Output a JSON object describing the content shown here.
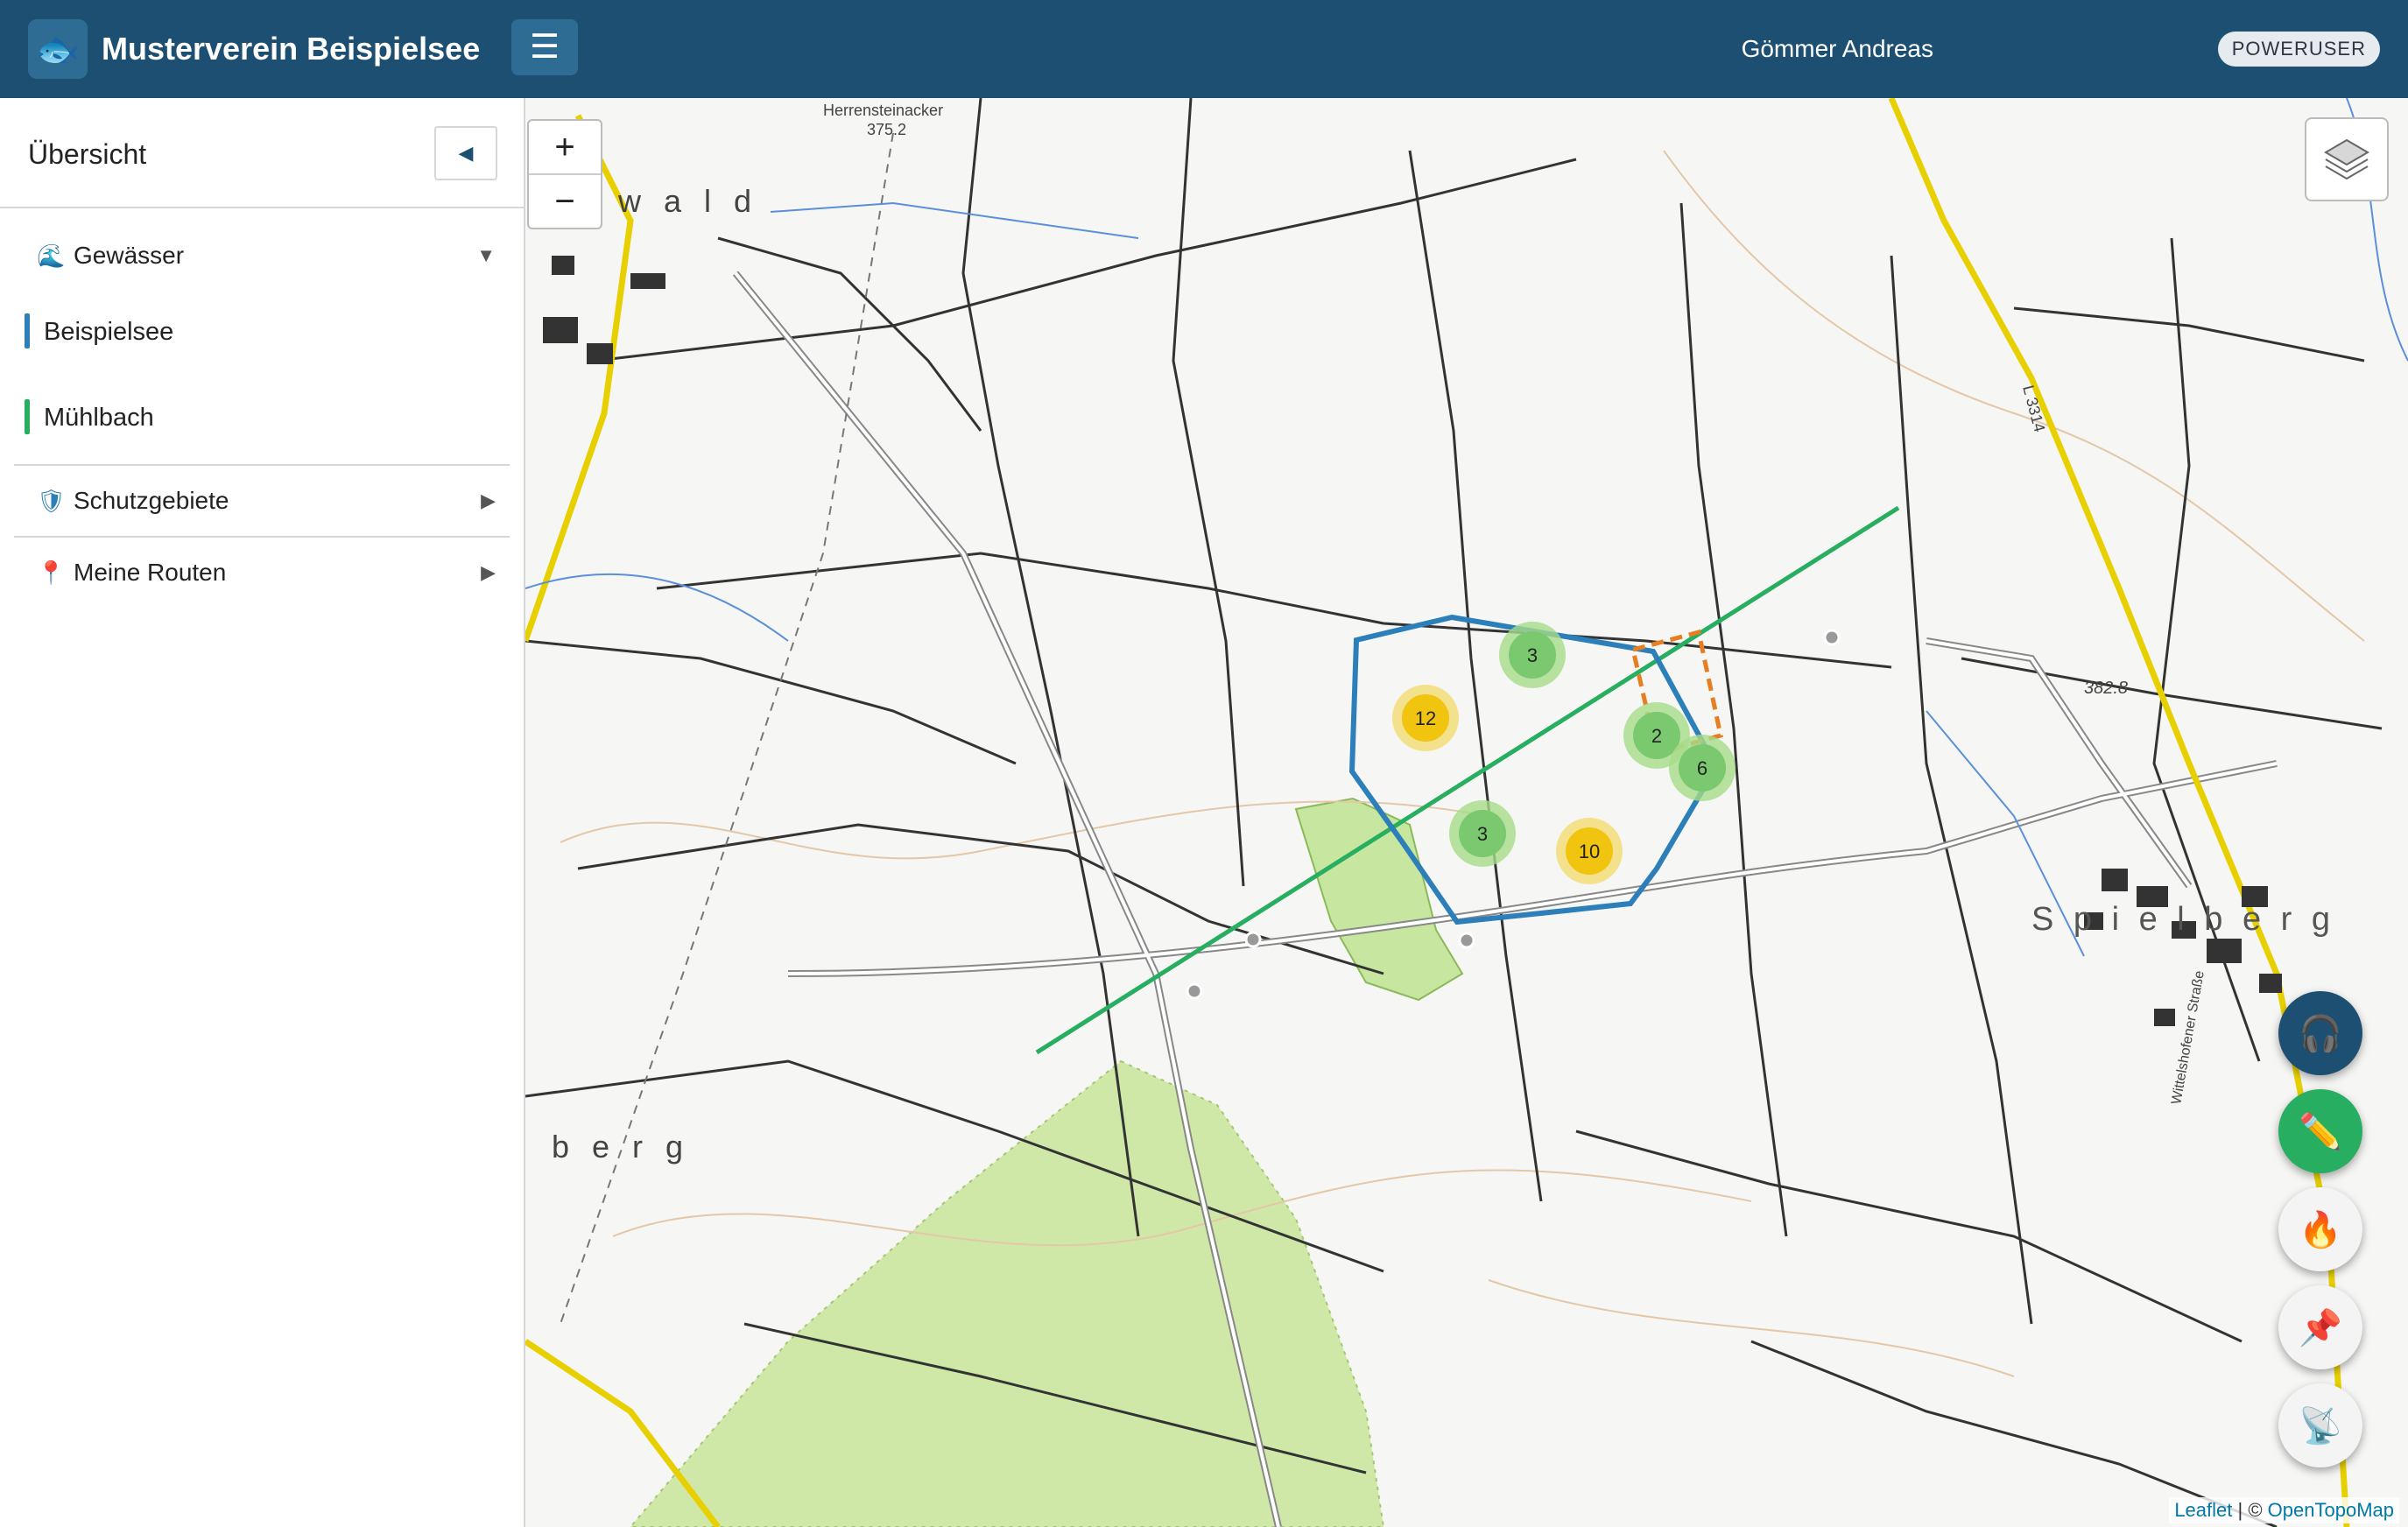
{
  "header": {
    "brand_icon": "fish-icon",
    "title": "Musterverein Beispielsee",
    "menu_icon": "hamburger-icon",
    "user_name": "Gömmer Andreas",
    "role_badge": "POWERUSER",
    "background": "#1d4f73"
  },
  "sidebar": {
    "title": "Übersicht",
    "collapse_icon": "triangle-left-icon",
    "groups": [
      {
        "label": "Gewässer",
        "icon": "water-wave-icon",
        "expanded": true,
        "items": [
          {
            "label": "Beispielsee",
            "color": "#2c7fb8"
          },
          {
            "label": "Mühlbach",
            "color": "#27ae60"
          }
        ]
      },
      {
        "label": "Schutzgebiete",
        "icon": "shield-icon",
        "expanded": false
      },
      {
        "label": "Meine Routen",
        "icon": "pin-icon",
        "expanded": false
      }
    ]
  },
  "map": {
    "zoom_in": "+",
    "zoom_out": "−",
    "place_labels": [
      "Herrensteinacker",
      "375.2",
      "n w a l d",
      "S p i e l b e r g",
      "b e r g",
      "382.8",
      "L 3314",
      "Wittelshofener Straße"
    ],
    "clusters": [
      {
        "count": "3",
        "color": "green"
      },
      {
        "count": "12",
        "color": "yellow"
      },
      {
        "count": "2",
        "color": "green"
      },
      {
        "count": "6",
        "color": "green"
      },
      {
        "count": "3",
        "color": "green"
      },
      {
        "count": "10",
        "color": "yellow"
      }
    ],
    "overlays": {
      "lake_polygon_color": "#2c7fb8",
      "stream_line_color": "#27ae60",
      "protected_area_color": "#e67e22"
    },
    "layer_control_icon": "layers-icon",
    "fabs": [
      {
        "name": "support-headset",
        "icon": "headset-icon",
        "color": "#1d4f73"
      },
      {
        "name": "edit-pencil",
        "icon": "pencil-icon",
        "color": "#27ae60"
      },
      {
        "name": "fire",
        "icon": "fire-icon",
        "color": "#f4f4f4"
      },
      {
        "name": "pin",
        "icon": "pushpin-icon",
        "color": "#f4f4f4"
      },
      {
        "name": "satellite",
        "icon": "satellite-dish-icon",
        "color": "#f4f4f4"
      }
    ],
    "attribution": {
      "leaflet": "Leaflet",
      "separator": "| ©",
      "provider": "OpenTopoMap"
    }
  }
}
